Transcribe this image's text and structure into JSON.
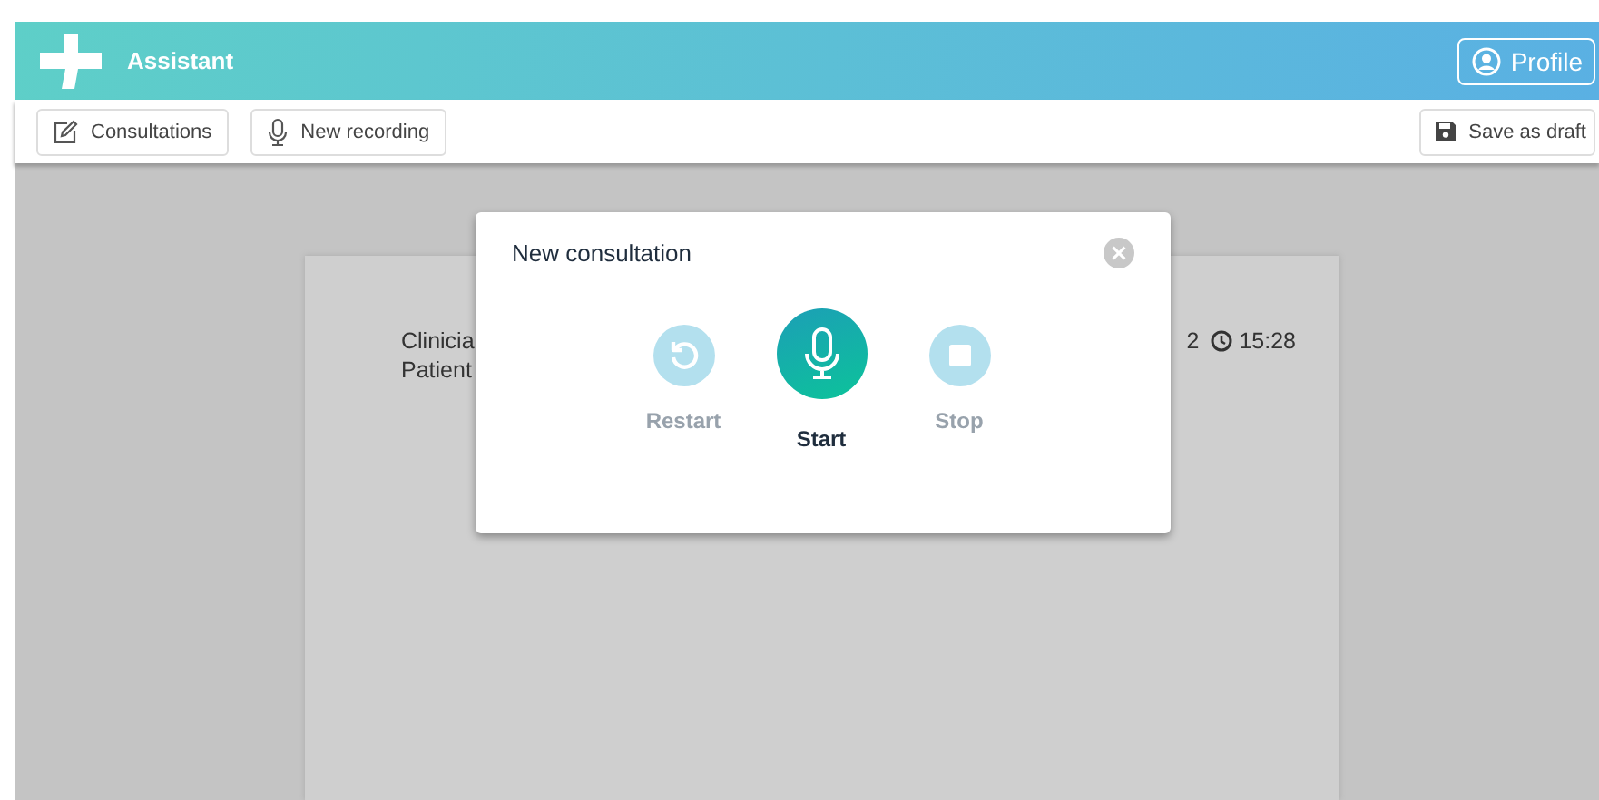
{
  "header": {
    "title": "Assistant",
    "profile_button": "Profile"
  },
  "toolbar": {
    "left_buttons": [
      {
        "kind": "edit",
        "label": "Consultations"
      },
      {
        "kind": "mic",
        "label": "New recording"
      }
    ],
    "save_button": "Save as draft"
  },
  "document": {
    "clinician_label": "Clinicia",
    "patient_label": "Patient",
    "date": "2",
    "time": "15:28"
  },
  "modal": {
    "title": "New consultation",
    "controls": [
      {
        "kind": "restart",
        "label": "Restart",
        "disabled": true
      },
      {
        "kind": "start",
        "label": "Start",
        "disabled": false
      },
      {
        "kind": "stop",
        "label": "Stop",
        "disabled": true
      }
    ]
  }
}
